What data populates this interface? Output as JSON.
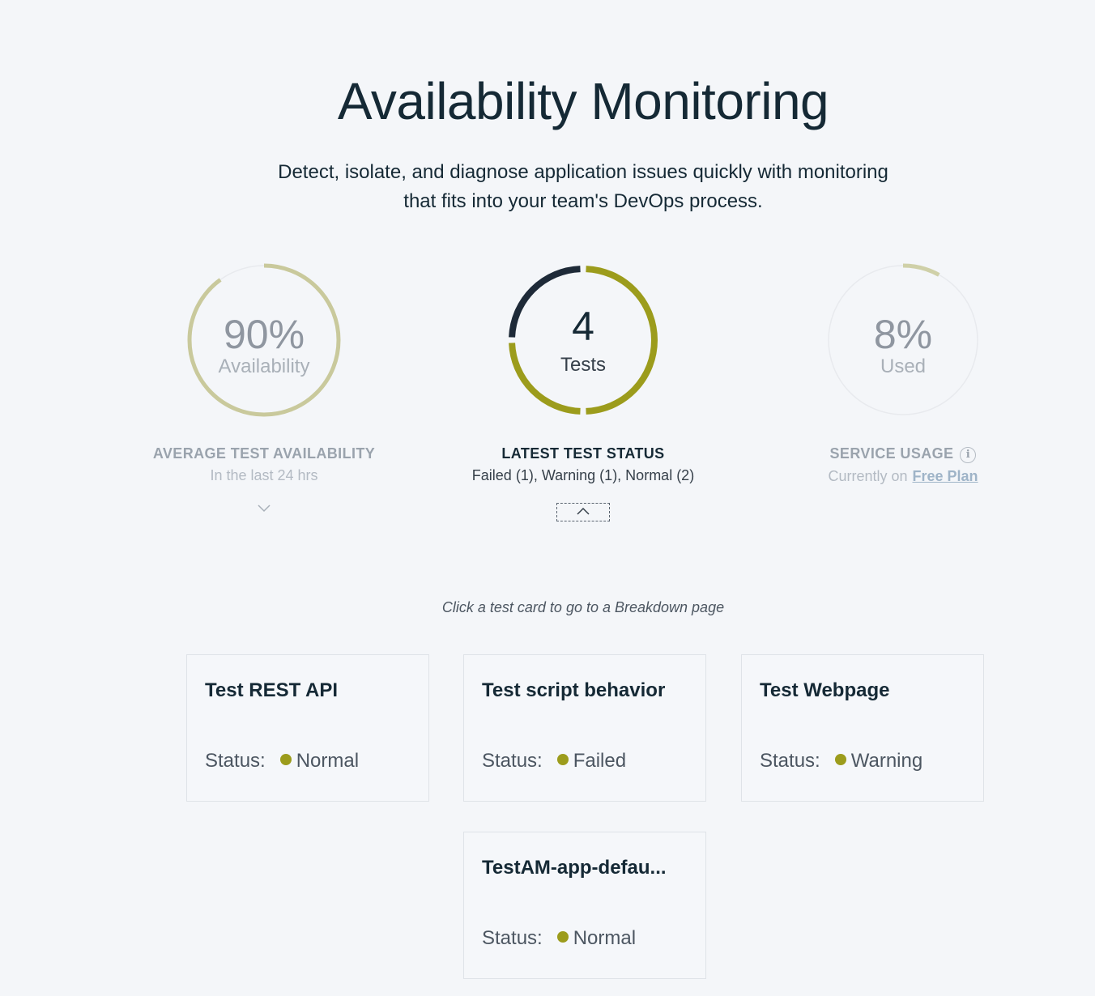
{
  "header": {
    "title": "Availability Monitoring",
    "subtitle_line1": "Detect, isolate, and diagnose application issues quickly with monitoring",
    "subtitle_line2": "that fits into your team's DevOps process."
  },
  "colors": {
    "accent": "#9c9c1c",
    "dark": "#1e2a38",
    "muted": "#c8c89a",
    "ring_track": "#e8eaee"
  },
  "metrics": {
    "availability": {
      "value": "90%",
      "caption": "Availability",
      "label": "AVERAGE TEST AVAILABILITY",
      "sub": "In the last 24 hrs",
      "fraction": 0.9
    },
    "tests": {
      "value": "4",
      "caption": "Tests",
      "label": "LATEST TEST STATUS",
      "sub": "Failed (1), Warning (1), Normal (2)",
      "failed": 1,
      "warning": 1,
      "normal": 2
    },
    "usage": {
      "value": "8%",
      "caption": "Used",
      "label": "SERVICE USAGE",
      "sub": "Currently on",
      "plan_link": "Free Plan",
      "fraction": 0.08
    }
  },
  "hint": "Click a test card to go to a Breakdown page",
  "status_label": "Status:",
  "cards": [
    {
      "title": "Test REST API",
      "status": "Normal"
    },
    {
      "title": "Test script behavior",
      "status": "Failed"
    },
    {
      "title": "Test Webpage",
      "status": "Warning"
    },
    {
      "title": "TestAM-app-defau...",
      "status": "Normal"
    }
  ]
}
